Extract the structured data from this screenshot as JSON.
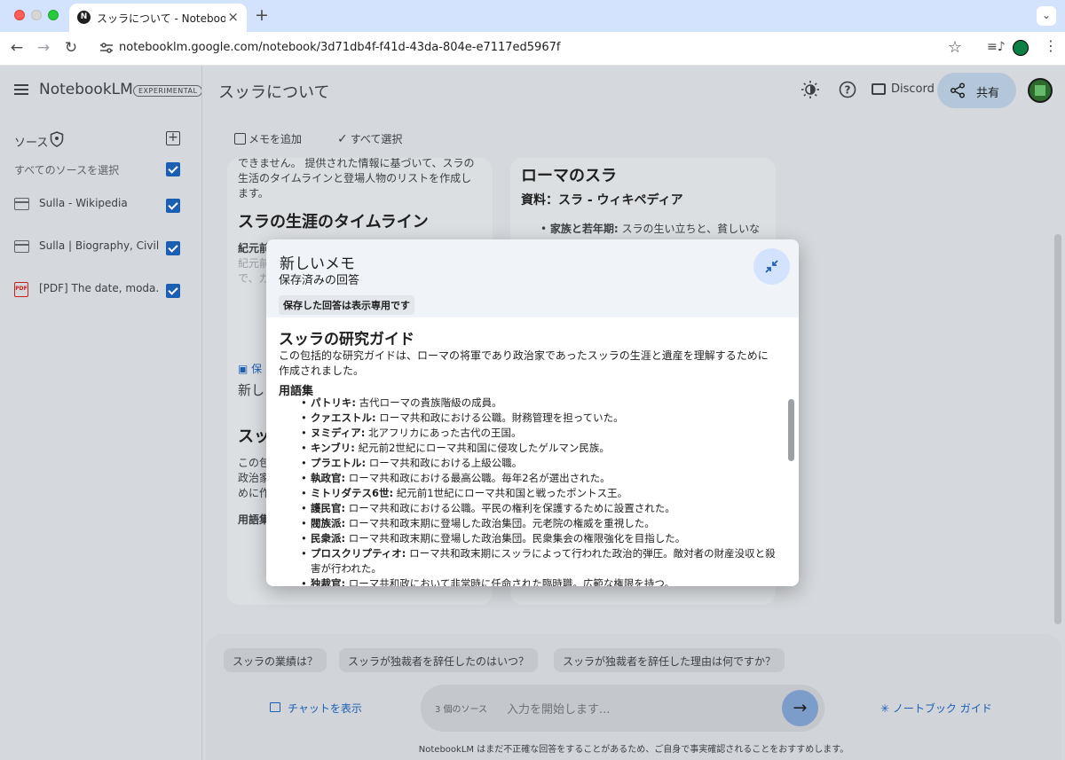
{
  "browser": {
    "tab_title": "スッラについて - NotebookLM",
    "tab_favicon_letter": "N",
    "url": "notebooklm.google.com/notebook/3d71db4f-f41d-43da-804e-e7117ed5967f"
  },
  "app": {
    "brand": "NotebookLM",
    "badge": "EXPERIMENTAL",
    "notebook_title": "スッラについて",
    "discord_label": "Discord",
    "share_label": "共有"
  },
  "sidebar": {
    "sources_label": "ソース",
    "select_all_label": "すべてのソースを選択",
    "items": [
      {
        "name": "Sulla - Wikipedia",
        "icon": "web-page-icon",
        "checked": true
      },
      {
        "name": "Sulla | Biography, Civil...",
        "icon": "web-page-icon",
        "checked": true
      },
      {
        "name": "[PDF] The date, moda...",
        "icon": "pdf-icon",
        "checked": true
      }
    ]
  },
  "main_toolbar": {
    "add_note": "メモを追加",
    "select_all": "すべて選択"
  },
  "cards": {
    "left_top": {
      "text_lines": [
        "できません。 提供された情報に基づいて、スラの",
        "生活のタイムラインと登場人物のリストを作成し",
        "ます。"
      ],
      "heading": "スラの生涯のタイムライン",
      "sub_lines": [
        "紀元前",
        "紀元前",
        "で、カ"
      ]
    },
    "right_top": {
      "heading": "ローマのスラ",
      "source_heading": "資料：スラ - ウィキペディア",
      "bullet_term": "家族と若年期:",
      "bullet_text": "スラの生い立ちと、貧しいな"
    },
    "left_bottom": {
      "tag": "保",
      "title_frag": "新し",
      "heading_frag": "スッ",
      "text_lines": [
        "この包",
        "政治家",
        "めに作"
      ],
      "sub_heading": "用語集"
    }
  },
  "modal": {
    "title": "新しいメモ",
    "subtitle": "保存済みの回答",
    "readonly_notice": "保存した回答は表示専用です",
    "doc_title": "スッラの研究ガイド",
    "intro": "この包括的な研究ガイドは、ローマの将軍であり政治家であったスッラの生涯と遺産を理解するために作成されました。",
    "glossary_title": "用語集",
    "glossary": [
      {
        "term": "パトリキ:",
        "def": " 古代ローマの貴族階級の成員。"
      },
      {
        "term": "クァエストル:",
        "def": " ローマ共和政における公職。財務管理を担っていた。"
      },
      {
        "term": "ヌミディア:",
        "def": " 北アフリカにあった古代の王国。"
      },
      {
        "term": "キンブリ:",
        "def": " 紀元前2世紀にローマ共和国に侵攻したゲルマン民族。"
      },
      {
        "term": "プラエトル:",
        "def": " ローマ共和政における上級公職。"
      },
      {
        "term": "執政官:",
        "def": " ローマ共和政における最高公職。毎年2名が選出された。"
      },
      {
        "term": "ミトリダテス6世:",
        "def": " 紀元前1世紀にローマ共和国と戦ったポントス王。"
      },
      {
        "term": "護民官:",
        "def": " ローマ共和政における公職。平民の権利を保護するために設置された。"
      },
      {
        "term": "閥族派:",
        "def": " ローマ共和政末期に登場した政治集団。元老院の権威を重視した。"
      },
      {
        "term": "民衆派:",
        "def": " ローマ共和政末期に登場した政治集団。民衆集会の権限強化を目指した。"
      },
      {
        "term": "プロスクリプティオ:",
        "def": " ローマ共和政末期にスッラによって行われた政治的弾圧。敵対者の財産没収と殺害が行われた。"
      },
      {
        "term": "独裁官:",
        "def": " ローマ共和政において非常時に任命された臨時職。広範な権限を持つ。"
      }
    ]
  },
  "chat": {
    "suggestions": [
      "スッラの業績は？",
      "スッラが独裁者を辞任したのはいつ？",
      "スッラが独裁者を辞任した理由は何ですか？"
    ],
    "show_chat": "チャットを表示",
    "source_count": "3 個のソース",
    "input_placeholder": "入力を開始します...",
    "notebook_guide": "ノートブック ガイド",
    "disclaimer": "NotebookLM はまだ不正確な回答をすることがあるため、ご自身で事実確認されることをおすすめします。"
  },
  "colors": {
    "accent": "#1a5fb4",
    "chrome": "#d3e3fd",
    "overlay_bg": "#d5d8dc"
  }
}
